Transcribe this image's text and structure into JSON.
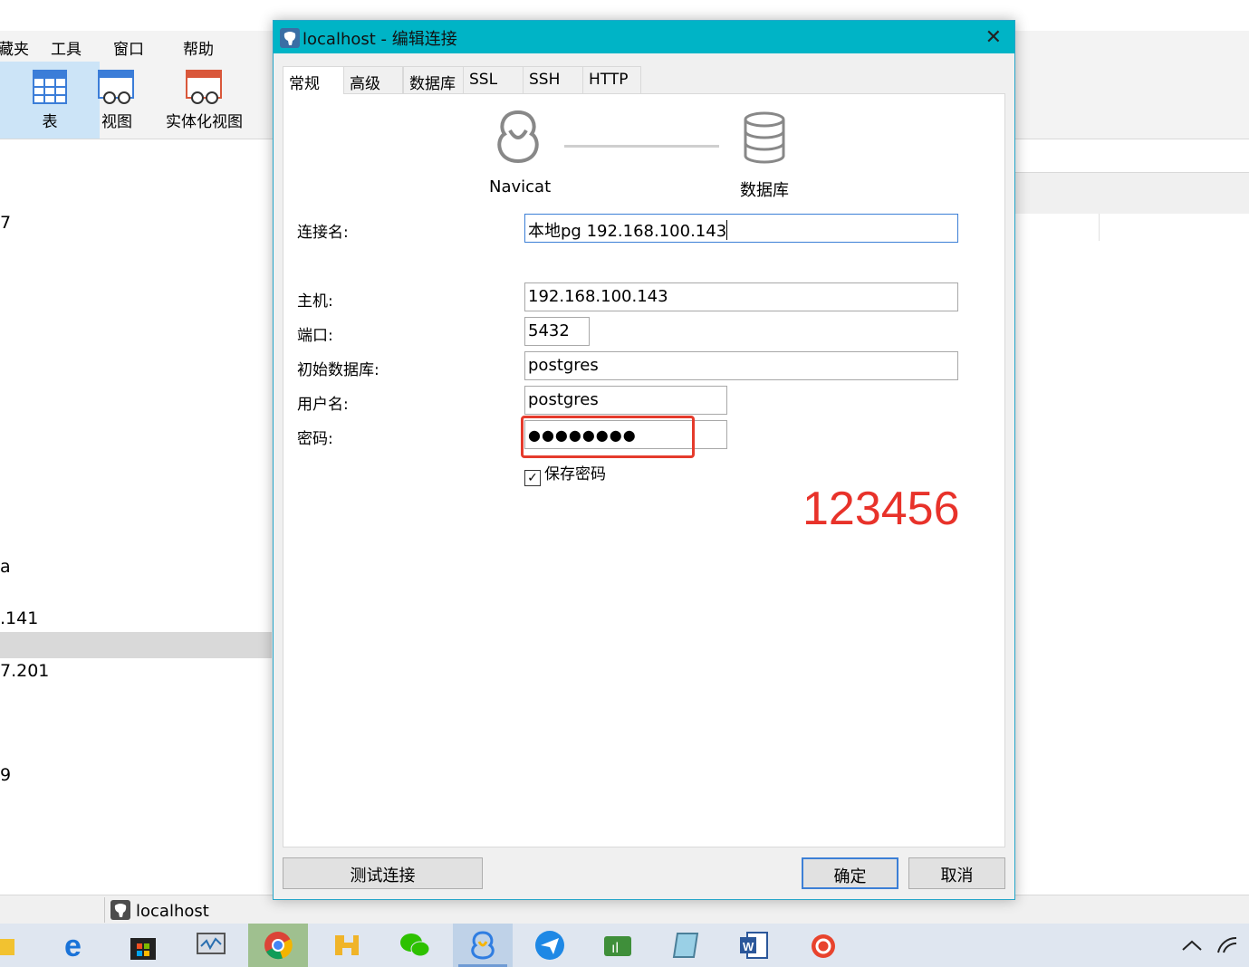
{
  "app": {
    "menu": [
      "藏夹",
      "工具",
      "窗口",
      "帮助"
    ],
    "ribbon": [
      {
        "label": "表",
        "icon": "table-icon",
        "active": true
      },
      {
        "label": "视图",
        "icon": "view-icon",
        "active": false
      },
      {
        "label": "实体化视图",
        "icon": "materialized-view-icon",
        "active": false
      }
    ],
    "tree_fragments": [
      "7",
      "a",
      ".141",
      "7.201",
      "9"
    ],
    "status_doc": "localhost"
  },
  "dialog": {
    "title": "localhost - 编辑连接",
    "tabs": [
      "常规",
      "高级",
      "数据库",
      "SSL",
      "SSH",
      "HTTP"
    ],
    "active_tab": "常规",
    "diagram": {
      "left_label": "Navicat",
      "right_label": "数据库"
    },
    "fields": {
      "connection_name": {
        "label": "连接名:",
        "value": "本地pg 192.168.100.143"
      },
      "host": {
        "label": "主机:",
        "value": "192.168.100.143"
      },
      "port": {
        "label": "端口:",
        "value": "5432"
      },
      "initial_db": {
        "label": "初始数据库:",
        "value": "postgres"
      },
      "username": {
        "label": "用户名:",
        "value": "postgres"
      },
      "password": {
        "label": "密码:",
        "value": "●●●●●●●●"
      }
    },
    "save_password": {
      "label": "保存密码",
      "checked": true
    },
    "annotation": "123456",
    "buttons": {
      "test": "测试连接",
      "ok": "确定",
      "cancel": "取消"
    }
  },
  "colors": {
    "titlebar": "#00b4c6",
    "annotation": "#e8322a",
    "focus": "#3c7fd6"
  },
  "taskbar": [
    "edge-icon",
    "store-icon",
    "monitor-icon",
    "chrome-icon",
    "app-icon",
    "wechat-icon",
    "navicat-icon",
    "message-icon",
    "ide-icon",
    "notepad-icon",
    "word-icon",
    "snail-icon"
  ]
}
